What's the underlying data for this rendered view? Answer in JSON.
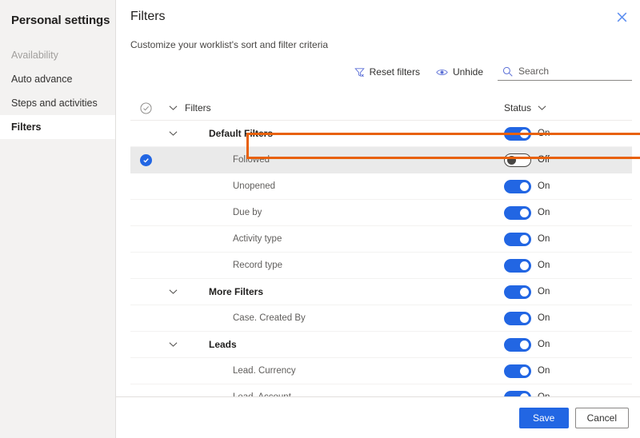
{
  "sidebar": {
    "title": "Personal settings",
    "items": [
      {
        "label": "Availability",
        "state": "disabled"
      },
      {
        "label": "Auto advance",
        "state": "normal"
      },
      {
        "label": "Steps and activities",
        "state": "normal"
      },
      {
        "label": "Filters",
        "state": "selected"
      }
    ]
  },
  "panel": {
    "title": "Filters",
    "subtitle": "Customize your worklist's sort and filter criteria",
    "close_label": "Close"
  },
  "commandbar": {
    "reset_filters_label": "Reset filters",
    "unhide_label": "Unhide",
    "search_placeholder": "Search",
    "search_value": ""
  },
  "table": {
    "header": {
      "name_label": "Filters",
      "status_label": "Status"
    },
    "rows": [
      {
        "label": "Default Filters",
        "indent": 1,
        "group": true,
        "status": "On",
        "toggle": "on",
        "checked": false,
        "highlighted": false
      },
      {
        "label": "Followed",
        "indent": 2,
        "group": false,
        "status": "Off",
        "toggle": "off",
        "checked": true,
        "highlighted": true
      },
      {
        "label": "Unopened",
        "indent": 2,
        "group": false,
        "status": "On",
        "toggle": "on",
        "checked": false,
        "highlighted": false
      },
      {
        "label": "Due by",
        "indent": 2,
        "group": false,
        "status": "On",
        "toggle": "on",
        "checked": false,
        "highlighted": false
      },
      {
        "label": "Activity type",
        "indent": 2,
        "group": false,
        "status": "On",
        "toggle": "on",
        "checked": false,
        "highlighted": false
      },
      {
        "label": "Record type",
        "indent": 2,
        "group": false,
        "status": "On",
        "toggle": "on",
        "checked": false,
        "highlighted": false
      },
      {
        "label": "More Filters",
        "indent": 1,
        "group": true,
        "status": "On",
        "toggle": "on",
        "checked": false,
        "highlighted": false
      },
      {
        "label": "Case. Created By",
        "indent": 2,
        "group": false,
        "status": "On",
        "toggle": "on",
        "checked": false,
        "highlighted": false
      },
      {
        "label": "Leads",
        "indent": 1,
        "group": true,
        "status": "On",
        "toggle": "on",
        "checked": false,
        "highlighted": false
      },
      {
        "label": "Lead. Currency",
        "indent": 2,
        "group": false,
        "status": "On",
        "toggle": "on",
        "checked": false,
        "highlighted": false
      },
      {
        "label": "Lead. Account",
        "indent": 2,
        "group": false,
        "status": "On",
        "toggle": "on",
        "checked": false,
        "highlighted": false
      }
    ]
  },
  "footer": {
    "save_label": "Save",
    "cancel_label": "Cancel"
  },
  "colors": {
    "accent_blue": "#2266e3",
    "highlight_orange": "#e8610a",
    "sidebar_bg": "#f3f2f1",
    "row_selected_bg": "#eaeaea"
  },
  "icons": {
    "close": "close-icon",
    "reset_filters": "funnel-reset-icon",
    "unhide": "eye-icon",
    "search": "search-icon",
    "select_all": "circle-check-icon",
    "chevron": "chevron-down-icon"
  }
}
